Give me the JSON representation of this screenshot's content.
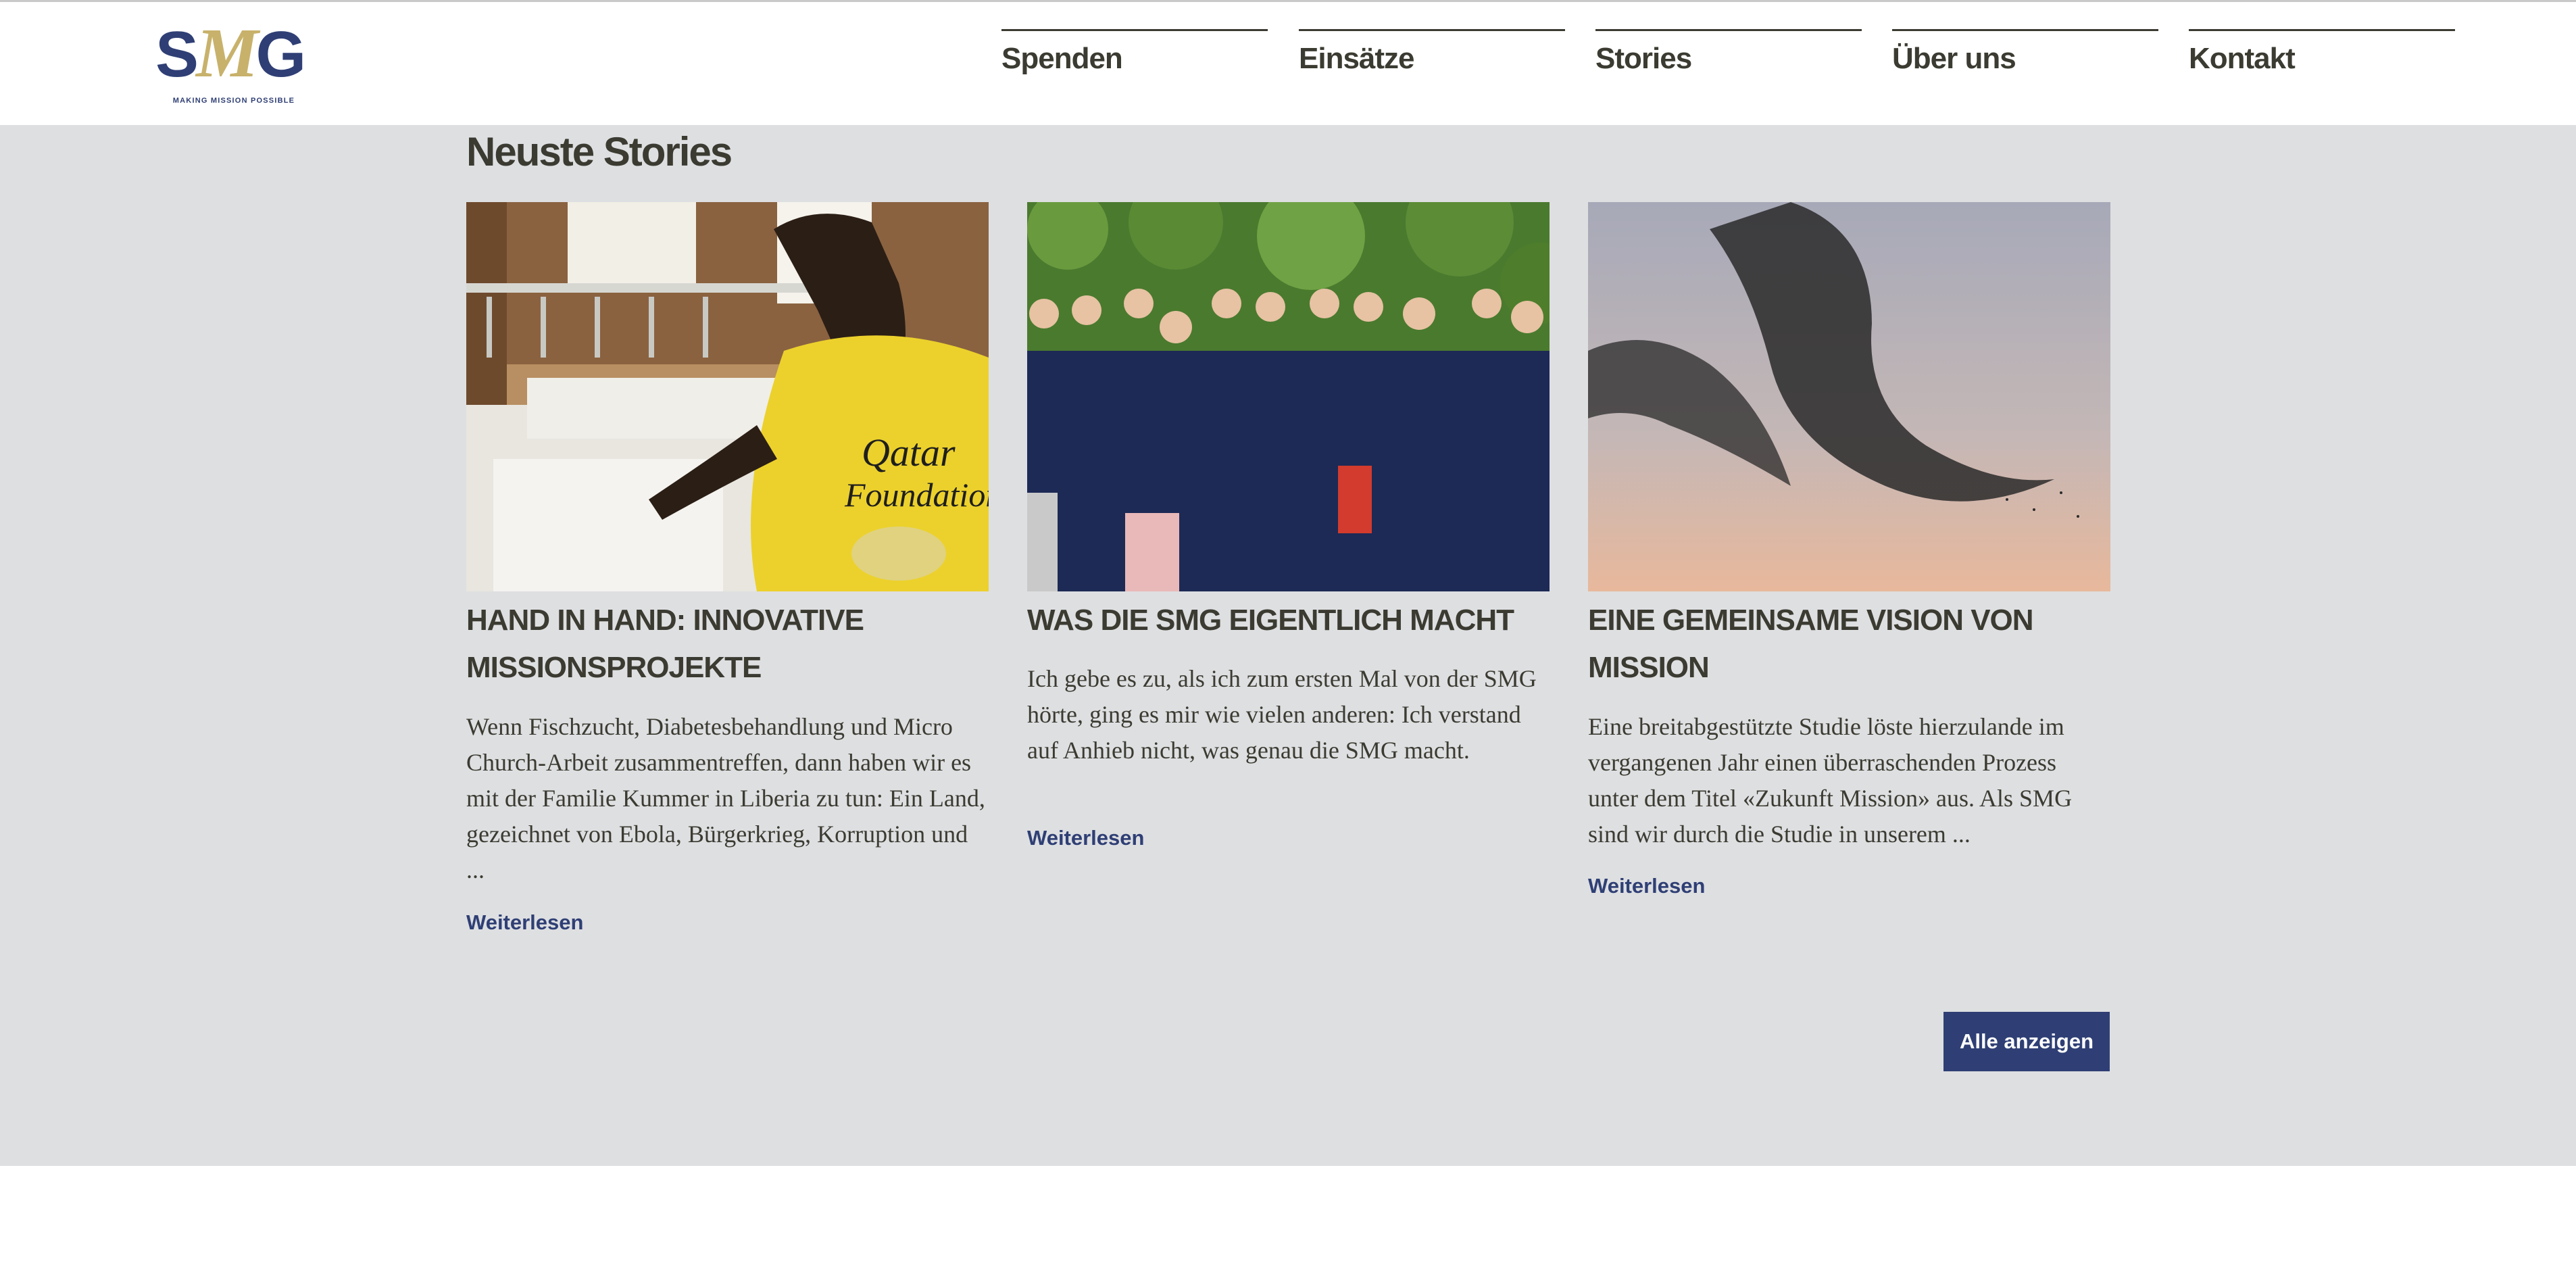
{
  "header": {
    "logo": {
      "text": "SMG",
      "tagline": "MAKING MISSION POSSIBLE"
    },
    "nav": [
      {
        "label": "Spenden"
      },
      {
        "label": "Einsätze"
      },
      {
        "label": "Stories"
      },
      {
        "label": "Über uns"
      },
      {
        "label": "Kontakt"
      }
    ]
  },
  "stories": {
    "title": "Neuste Stories",
    "items": [
      {
        "image": "man-sorting-fish-tanks-photo",
        "title": "HAND IN HAND: INNOVATIVE MISSIONSPROJEKTE",
        "excerpt": "Wenn Fischzucht, Diabetesbehandlung und Micro Church-Arbeit zusammentreffen, dann haben wir es mit der Familie Kummer in Liberia zu tun: Ein Land, gezeichnet von Ebola, Bürgerkrieg, Korruption und ...",
        "link": "Weiterlesen"
      },
      {
        "image": "team-group-photo",
        "title": "WAS DIE SMG EIGENTLICH MACHT",
        "excerpt": "Ich gebe es zu, als ich zum ersten Mal von der SMG hörte, ging es mir wie vielen anderen: Ich verstand auf Anhieb nicht, was genau die SMG macht.",
        "link": "Weiterlesen"
      },
      {
        "image": "bird-flock-sky-photo",
        "title": "EINE GEMEINSAME VISION VON MISSION",
        "excerpt": "Eine breitabgestützte Studie löste hierzulande im vergangenen Jahr einen überraschenden Prozess unter dem Titel «Zukunft Mission» aus. Als SMG sind wir durch die Studie in unserem ...",
        "link": "Weiterlesen"
      }
    ],
    "show_all": "Alle anzeigen"
  },
  "colors": {
    "brand_navy": "#2f3f75",
    "brand_gold": "#c8b26b",
    "section_bg": "#dedfe1",
    "text_dark": "#3b3b32"
  }
}
